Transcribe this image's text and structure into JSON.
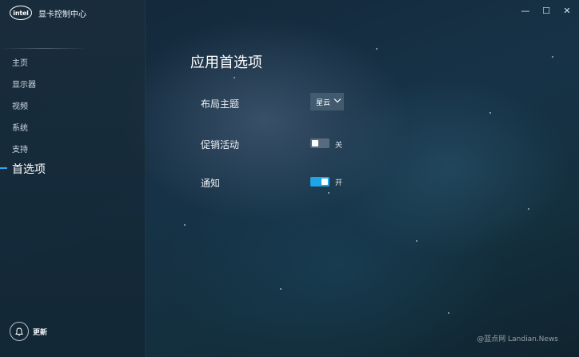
{
  "app": {
    "logo_text": "intel",
    "title": "显卡控制中心",
    "window_buttons": {
      "minimize": "—",
      "maximize": "☐",
      "close": "✕"
    }
  },
  "sidebar": {
    "items": [
      {
        "label": "主页"
      },
      {
        "label": "显示器"
      },
      {
        "label": "视频"
      },
      {
        "label": "系统"
      },
      {
        "label": "支持"
      },
      {
        "label": "首选项",
        "active": true
      }
    ],
    "update_label": "更新",
    "accent_color": "#2aa8e8"
  },
  "main": {
    "page_title": "应用首选项",
    "layout_theme": {
      "label": "布局主题",
      "value": "星云"
    },
    "promotions": {
      "label": "促销活动",
      "enabled": false,
      "state_label": "关"
    },
    "notifications": {
      "label": "通知",
      "enabled": true,
      "state_label": "开"
    }
  },
  "watermark": "@蓝点网 Landian.News",
  "icons": [
    "bell-icon",
    "chevron-down-icon",
    "minimize-icon",
    "maximize-icon",
    "close-icon"
  ]
}
